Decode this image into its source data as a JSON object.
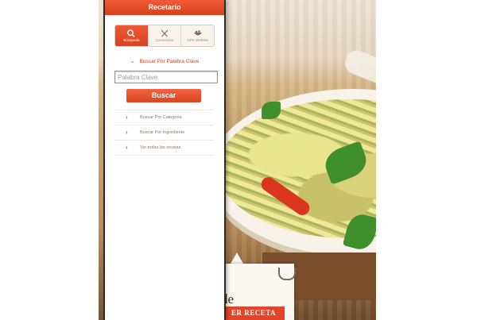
{
  "app": {
    "title": "Recetario"
  },
  "tabs": [
    {
      "label": "Búsqueda",
      "icon": "search-icon",
      "active": true
    },
    {
      "label": "Conversión",
      "icon": "utensils-icon",
      "active": false
    },
    {
      "label": "GPK Website",
      "icon": "bowl-icon",
      "active": false
    }
  ],
  "section": {
    "title": "Buscar Por Palabra Clave"
  },
  "search": {
    "placeholder": "Palabra Clave",
    "value": "",
    "button_label": "Buscar"
  },
  "menu": [
    {
      "label": "Buscar Por Categoria"
    },
    {
      "label": "Buscar Por Ingrediente"
    },
    {
      "label": "Ver todas las recetas"
    }
  ],
  "background": {
    "card_text": "de",
    "card_button": "ER RECETA"
  },
  "colors": {
    "accent": "#e0502c",
    "panel_bg": "#ffffff",
    "border": "#2b2b2b"
  }
}
